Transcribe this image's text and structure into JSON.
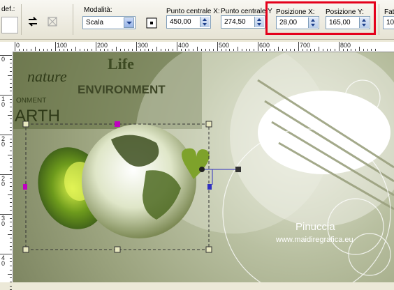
{
  "toolbar": {
    "preset_label": "def.:",
    "mode_label": "Modalità:",
    "mode_value": "Scala",
    "center_x_label": "Punto centrale X:",
    "center_x_value": "450,00",
    "center_y_label": "Punto centrale Y",
    "center_y_value": "274,50",
    "pos_x_label": "Posizione X:",
    "pos_x_value": "28,00",
    "pos_y_label": "Posizione Y:",
    "pos_y_value": "165,00",
    "cut_label": "Fat",
    "cut_value": "10"
  },
  "ruler": {
    "h_labels": [
      "0",
      "100",
      "200",
      "300",
      "400",
      "500",
      "600",
      "700",
      "800"
    ],
    "v_labels": [
      "0",
      "1 0",
      "2 0",
      "2 0",
      "3 0",
      "4 0"
    ]
  },
  "canvas": {
    "word_life": "Life",
    "word_nature": "nature",
    "word_environment": "ENVIRONMENT",
    "word_onment": "ONMENT",
    "word_arth": "ARTH",
    "watermark_name": "Pinuccia",
    "watermark_site": "www.maidiregrafica.eu"
  },
  "colors": {
    "highlight_box": "#e4001b",
    "selection_handle": "#c000c0"
  }
}
